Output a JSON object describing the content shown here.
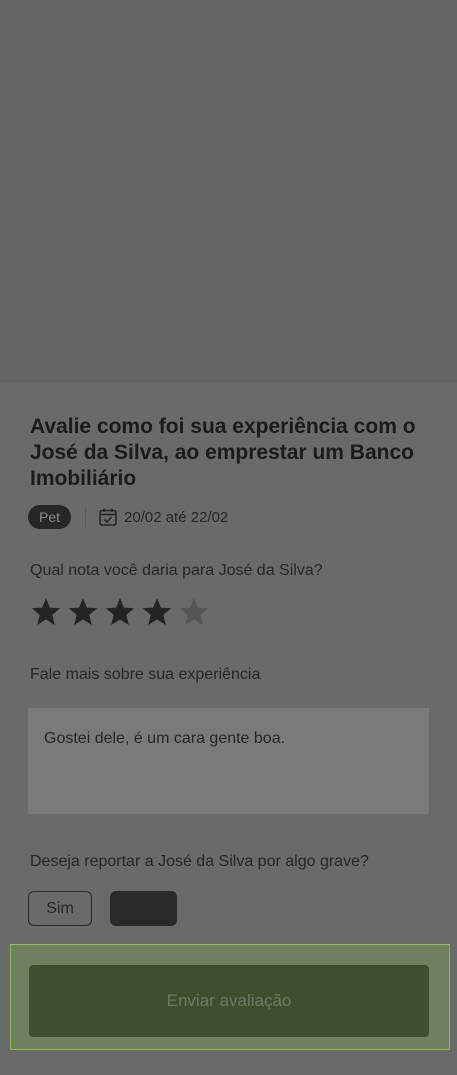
{
  "review": {
    "title": "Avalie como foi sua experiência com o José da Silva, ao emprestar um Banco Imobiliário",
    "tag": "Pet",
    "date_range": "20/02 até 22/02",
    "rating_question": "Qual nota você daria para José da Silva?",
    "rating": {
      "value": 4,
      "max": 5
    },
    "comment_label": "Fale mais sobre sua experiência",
    "comment_value": "Gostei dele, é um cara gente boa.",
    "report_question": "Deseja reportar a José da Silva por algo grave?",
    "report_options": {
      "yes": "Sim",
      "no": ""
    },
    "submit_label": "Enviar avaliação"
  },
  "colors": {
    "overlay": "#666666",
    "cta_bg": "#3d4f2d",
    "cta_highlight": "#8bc34a"
  }
}
